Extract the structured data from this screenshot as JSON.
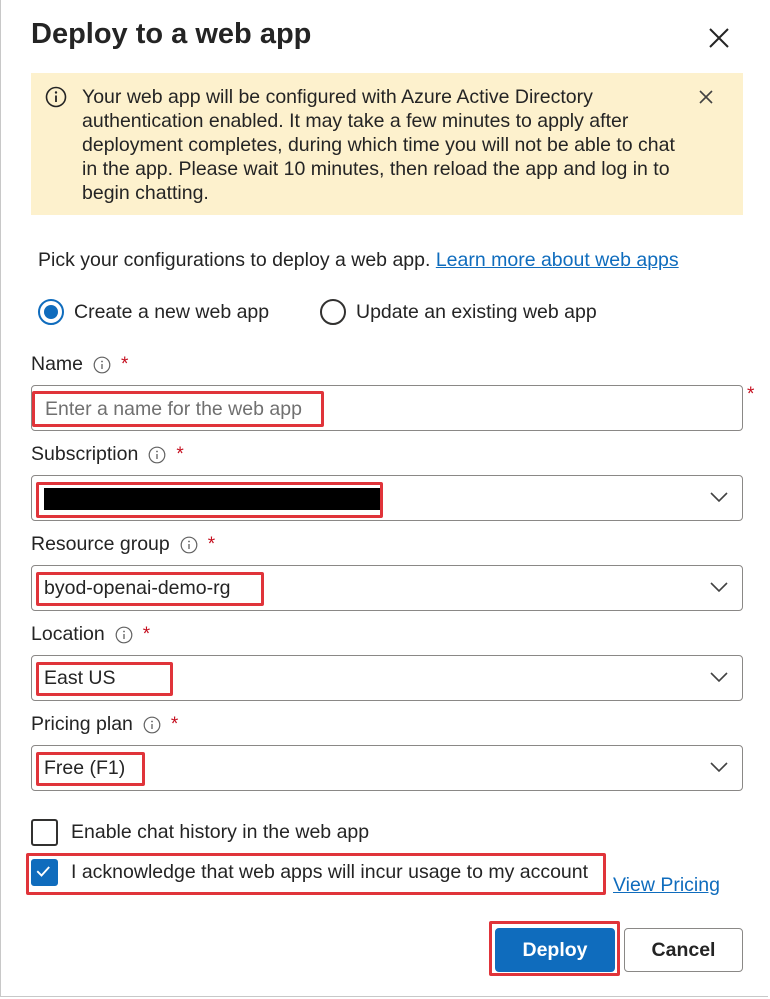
{
  "dialog": {
    "title": "Deploy to a web app",
    "banner_text": "Your web app will be configured with Azure Active Directory authentication enabled. It may take a few minutes to apply after deployment completes, during which time you will not be able to chat in the app. Please wait 10 minutes, then reload the app and log in to begin chatting.",
    "intro_text": "Pick your configurations to deploy a web app.",
    "learn_more_link": "Learn more about web apps"
  },
  "mode": {
    "options": [
      {
        "label": "Create a new web app",
        "selected": true
      },
      {
        "label": "Update an existing web app",
        "selected": false
      }
    ]
  },
  "form": {
    "required_marker": "*",
    "name": {
      "label": "Name",
      "value": "",
      "placeholder": "Enter a name for the web app"
    },
    "subscription": {
      "label": "Subscription",
      "value": "[redacted]"
    },
    "resource_group": {
      "label": "Resource group",
      "value": "byod-openai-demo-rg"
    },
    "location": {
      "label": "Location",
      "value": "East US"
    },
    "pricing_plan": {
      "label": "Pricing plan",
      "value": "Free (F1)"
    }
  },
  "checks": {
    "chat_history": {
      "label": "Enable chat history in the web app",
      "checked": false
    },
    "acknowledge": {
      "label": "I acknowledge that web apps will incur usage to my account",
      "checked": true
    },
    "view_pricing_link": "View Pricing"
  },
  "buttons": {
    "deploy": "Deploy",
    "cancel": "Cancel"
  },
  "colors": {
    "accent": "#0f6cbd",
    "banner_bg": "#fdf1cd",
    "highlight": "#e0343a",
    "required": "#c50f1f"
  },
  "icons": {
    "close": "close-icon",
    "info": "info-icon",
    "chevron": "chevron-down-icon",
    "check": "checkmark-icon"
  }
}
